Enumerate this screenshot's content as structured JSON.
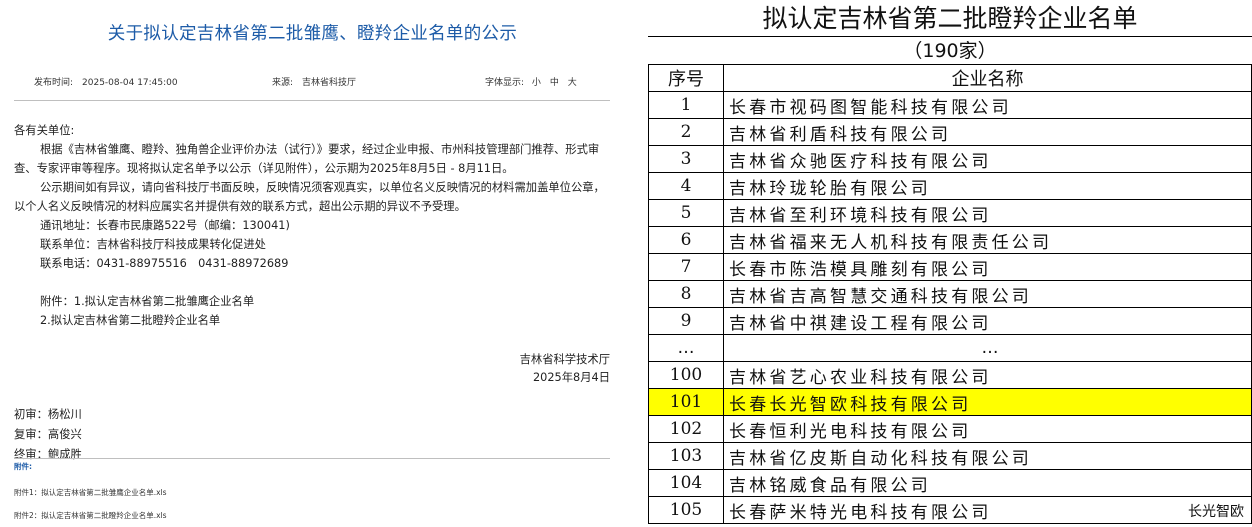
{
  "announcement": {
    "title": "关于拟认定吉林省第二批雏鹰、瞪羚企业名单的公示",
    "meta": {
      "publish_time": "发布时间:　2025-08-04 17:45:00",
      "source": "来源:　吉林省科技厅",
      "font_label": "字体显示:",
      "font_small": "小",
      "font_medium": "中",
      "font_large": "大"
    },
    "body": {
      "greeting": "各有关单位:",
      "para1": "根据《吉林省雏鹰、瞪羚、独角兽企业评价办法（试行）》要求，经过企业申报、市州科技管理部门推荐、形式审查、专家评审等程序。现将拟认定名单予以公示（详见附件），公示期为2025年8月5日 - 8月11日。",
      "para2": "公示期间如有异议，请向省科技厅书面反映，反映情况须客观真实，以单位名义反映情况的材料需加盖单位公章，以个人名义反映情况的材料应属实名并提供有效的联系方式，超出公示期的异议不予受理。",
      "address": "通讯地址：长春市民康路522号（邮编：130041)",
      "contact_unit": "联系单位：吉林省科技厅科技成果转化促进处",
      "phone": "联系电话：0431-88975516　0431-88972689",
      "attach_line1": "附件：1.拟认定吉林省第二批雏鹰企业名单",
      "attach_line2": "2.拟认定吉林省第二批瞪羚企业名单"
    },
    "signature": {
      "org": "吉林省科学技术厅",
      "date": "2025年8月4日"
    },
    "reviewers": {
      "first": "初审：杨松川",
      "second": "复审：高俊兴",
      "final": "终审：鲍成胜"
    },
    "attachments": {
      "label": "附件:",
      "file1": "附件1：拟认定吉林省第二批雏鹰企业名单.xls",
      "file2": "附件2：拟认定吉林省第二批瞪羚企业名单.xls"
    }
  },
  "table": {
    "title": "拟认定吉林省第二批瞪羚企业名单",
    "count": "（190家）",
    "header_seq": "序号",
    "header_name": "企业名称",
    "rows": [
      {
        "seq": "1",
        "name": "长春市视码图智能科技有限公司"
      },
      {
        "seq": "2",
        "name": "吉林省利盾科技有限公司"
      },
      {
        "seq": "3",
        "name": "吉林省众驰医疗科技有限公司"
      },
      {
        "seq": "4",
        "name": "吉林玲珑轮胎有限公司"
      },
      {
        "seq": "5",
        "name": "吉林省至利环境科技有限公司"
      },
      {
        "seq": "6",
        "name": "吉林省福来无人机科技有限责任公司"
      },
      {
        "seq": "7",
        "name": "长春市陈浩模具雕刻有限公司"
      },
      {
        "seq": "8",
        "name": "吉林省吉高智慧交通科技有限公司"
      },
      {
        "seq": "9",
        "name": "吉林省中祺建设工程有限公司"
      },
      {
        "seq": "…",
        "name": "…"
      },
      {
        "seq": "100",
        "name": "吉林省艺心农业科技有限公司"
      },
      {
        "seq": "101",
        "name": "长春长光智欧科技有限公司"
      },
      {
        "seq": "102",
        "name": "长春恒利光电科技有限公司"
      },
      {
        "seq": "103",
        "name": "吉林省亿皮斯自动化科技有限公司"
      },
      {
        "seq": "104",
        "name": "吉林铭威食品有限公司"
      },
      {
        "seq": "105",
        "name": "长春萨米特光电科技有限公司"
      }
    ],
    "highlight_color": "#ffff00"
  },
  "watermark": "长光智欧"
}
